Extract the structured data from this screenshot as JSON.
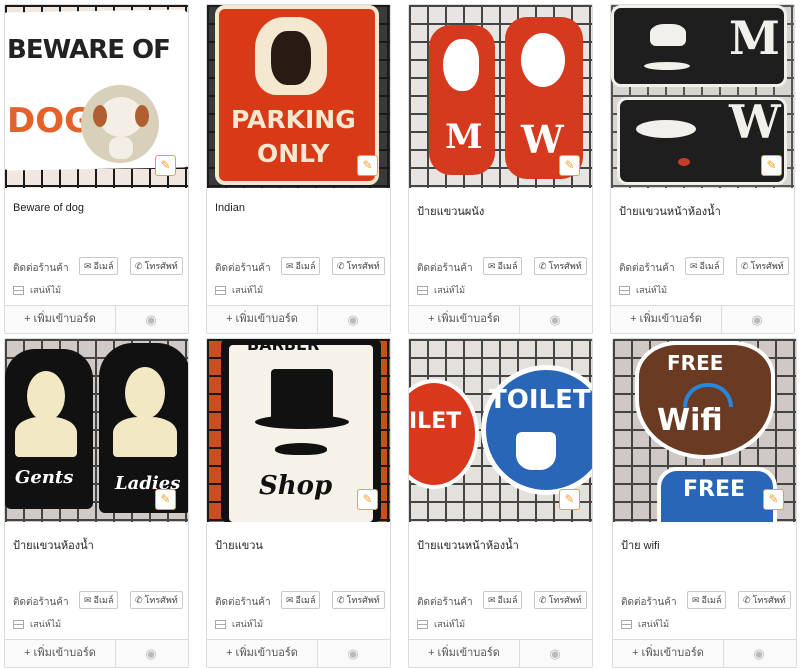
{
  "common": {
    "contact_label": "ติดต่อร้านค้า",
    "email_label": "อีเมล์",
    "phone_label": "โทรศัพท์",
    "material_label": "เสน่ห์ไม้",
    "add_label": "+ เพิ่มเข้าบอร์ด"
  },
  "products": [
    {
      "title": "Beware of dog",
      "sign_lines": [
        "BEWARE OF",
        "DOG"
      ]
    },
    {
      "title": "Indian",
      "sign_lines": [
        "PARKING",
        "ONLY"
      ]
    },
    {
      "title": "ป้ายแขวนผนัง",
      "sign_lines": [
        "M",
        "W"
      ]
    },
    {
      "title": "ป้ายแขวนหน้าห้องน้ำ",
      "sign_lines": [
        "M",
        "W"
      ]
    },
    {
      "title": "ป้ายแขวนห้องน้ำ",
      "sign_lines": [
        "Gents",
        "Ladies"
      ]
    },
    {
      "title": "ป้ายแขวน",
      "sign_lines": [
        "BARBER",
        "Shop"
      ]
    },
    {
      "title": "ป้ายแขวนหน้าห้องน้ำ",
      "sign_lines": [
        "ILET",
        "TOILET"
      ]
    },
    {
      "title": "ป้าย wifi",
      "sign_lines": [
        "FREE",
        "Wifi",
        "FREE"
      ]
    }
  ]
}
